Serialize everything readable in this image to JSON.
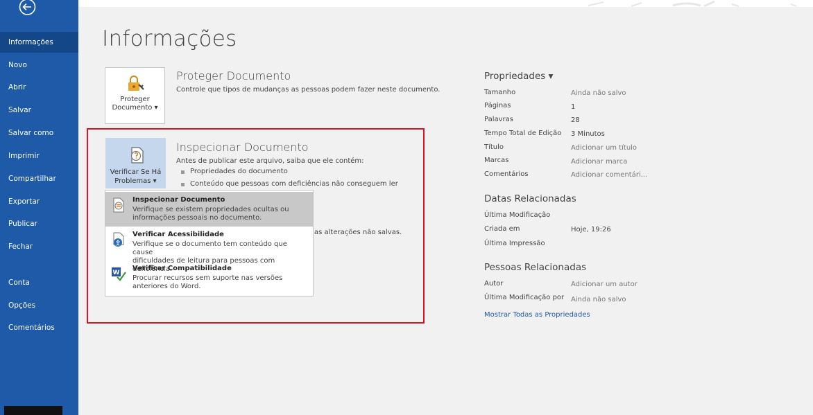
{
  "sidebar": {
    "items": [
      {
        "label": "Informações",
        "active": true
      },
      {
        "label": "Novo"
      },
      {
        "label": "Abrir"
      },
      {
        "label": "Salvar"
      },
      {
        "label": "Salvar como"
      },
      {
        "label": "Imprimir"
      },
      {
        "label": "Compartilhar"
      },
      {
        "label": "Exportar"
      },
      {
        "label": "Publicar"
      },
      {
        "label": "Fechar"
      },
      {
        "label": "Conta"
      },
      {
        "label": "Opções"
      },
      {
        "label": "Comentários"
      }
    ]
  },
  "page": {
    "title": "Informações"
  },
  "protect": {
    "button_line1": "Proteger",
    "button_line2": "Documento ▾",
    "heading": "Proteger Documento",
    "description": "Controle que tipos de mudanças as pessoas podem fazer neste documento."
  },
  "inspect": {
    "button_line1": "Verificar Se Há",
    "button_line2": "Problemas ▾",
    "heading": "Inspecionar Documento",
    "description": "Antes de publicar este arquivo, saiba que ele contém:",
    "bullets": [
      "Propriedades do documento",
      "Conteúdo que pessoas com deficiências não conseguem ler"
    ],
    "unsaved_text": "as alterações não salvas."
  },
  "menu": {
    "items": [
      {
        "title": "Inspecionar Documento",
        "desc1": "Verifique se existem propriedades ocultas ou",
        "desc2": "informações pessoais no documento."
      },
      {
        "title": "Verificar Acessibilidade",
        "desc1": "Verifique se o documento tem conteúdo que cause",
        "desc2": "dificuldades de leitura para pessoas com deficiência."
      },
      {
        "title": "Verificar Compatibilidade",
        "desc1": "Procurar recursos sem suporte nas versões",
        "desc2": "anteriores do Word."
      }
    ]
  },
  "properties": {
    "heading": "Propriedades ▾",
    "rows": [
      {
        "label": "Tamanho",
        "value": "Ainda não salvo"
      },
      {
        "label": "Páginas",
        "value": "1"
      },
      {
        "label": "Palavras",
        "value": "28"
      },
      {
        "label": "Tempo Total de Edição",
        "value": "3 Minutos"
      },
      {
        "label": "Título",
        "value": "Adicionar um título"
      },
      {
        "label": "Marcas",
        "value": "Adicionar marca"
      },
      {
        "label": "Comentários",
        "value": "Adicionar comentári..."
      }
    ]
  },
  "dates": {
    "heading": "Datas Relacionadas",
    "rows": [
      {
        "label": "Última Modificação",
        "value": ""
      },
      {
        "label": "Criada em",
        "value": "Hoje, 19:26"
      },
      {
        "label": "Última Impressão",
        "value": ""
      }
    ]
  },
  "people": {
    "heading": "Pessoas Relacionadas",
    "rows": [
      {
        "label": "Autor",
        "value": "Adicionar um autor"
      },
      {
        "label": "Última Modificação por",
        "value": "Ainda não salvo"
      }
    ],
    "show_all_link": "Mostrar Todas as Propriedades"
  },
  "colors": {
    "sidebar": "#1e5aa7",
    "sidebar_active": "#144787",
    "highlight_box": "#e81123",
    "link": "#1e5aa7"
  }
}
